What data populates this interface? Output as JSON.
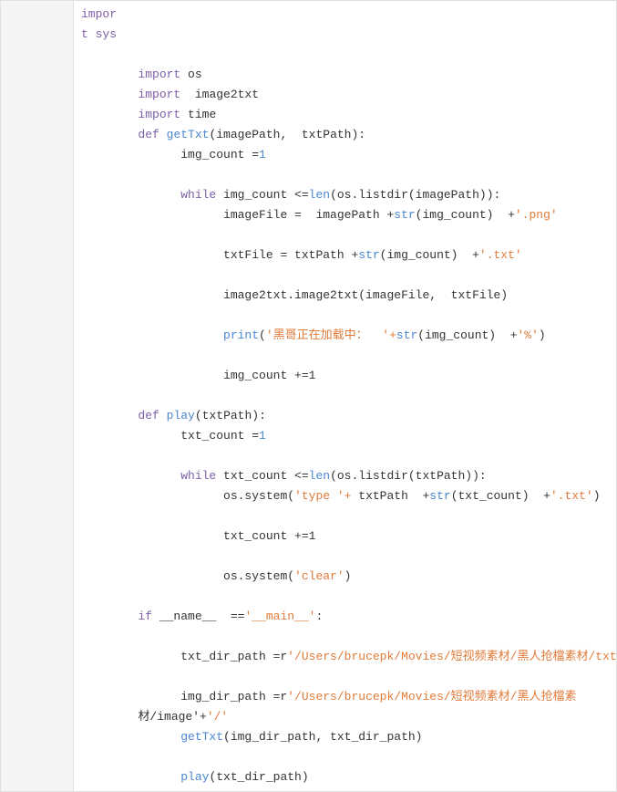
{
  "lines": [
    {
      "num": "",
      "tokens": [
        {
          "t": "kw",
          "v": "impor"
        }
      ]
    },
    {
      "num": "",
      "tokens": [
        {
          "t": "kw",
          "v": "t sys"
        }
      ]
    },
    {
      "num": "",
      "tokens": []
    },
    {
      "num": "",
      "tokens": [
        {
          "t": "plain",
          "v": "        "
        },
        {
          "t": "kw",
          "v": "import"
        },
        {
          "t": "plain",
          "v": " os"
        }
      ]
    },
    {
      "num": "",
      "tokens": [
        {
          "t": "plain",
          "v": "        "
        },
        {
          "t": "kw",
          "v": "import"
        },
        {
          "t": "plain",
          "v": "  image2txt"
        }
      ]
    },
    {
      "num": "",
      "tokens": [
        {
          "t": "plain",
          "v": "        "
        },
        {
          "t": "kw",
          "v": "import"
        },
        {
          "t": "plain",
          "v": " time"
        }
      ]
    },
    {
      "num": "",
      "tokens": [
        {
          "t": "plain",
          "v": "        "
        },
        {
          "t": "kw",
          "v": "def"
        },
        {
          "t": "plain",
          "v": " "
        },
        {
          "t": "fn",
          "v": "getTxt"
        },
        {
          "t": "plain",
          "v": "(imagePath,  txtPath):"
        }
      ]
    },
    {
      "num": "",
      "tokens": [
        {
          "t": "plain",
          "v": "              "
        },
        {
          "t": "plain",
          "v": "img_count ="
        },
        {
          "t": "num",
          "v": "1"
        }
      ]
    },
    {
      "num": "",
      "tokens": []
    },
    {
      "num": "",
      "tokens": [
        {
          "t": "plain",
          "v": "              "
        },
        {
          "t": "kw",
          "v": "while"
        },
        {
          "t": "plain",
          "v": " img_count <="
        },
        {
          "t": "builtin",
          "v": "len"
        },
        {
          "t": "plain",
          "v": "(os.listdir(imagePath)):"
        }
      ]
    },
    {
      "num": "",
      "tokens": [
        {
          "t": "plain",
          "v": "                    "
        },
        {
          "t": "plain",
          "v": "imageFile =  imagePath +"
        },
        {
          "t": "builtin",
          "v": "str"
        },
        {
          "t": "plain",
          "v": "(img_count)  +"
        },
        {
          "t": "str",
          "v": "'.png'"
        }
      ]
    },
    {
      "num": "",
      "tokens": []
    },
    {
      "num": "",
      "tokens": [
        {
          "t": "plain",
          "v": "                    "
        },
        {
          "t": "plain",
          "v": "txtFile = txtPath +"
        },
        {
          "t": "builtin",
          "v": "str"
        },
        {
          "t": "plain",
          "v": "(img_count)  +"
        },
        {
          "t": "str",
          "v": "'.txt'"
        }
      ]
    },
    {
      "num": "",
      "tokens": []
    },
    {
      "num": "",
      "tokens": [
        {
          "t": "plain",
          "v": "                    "
        },
        {
          "t": "plain",
          "v": "image2txt.image2txt(imageFile,  txtFile)"
        }
      ]
    },
    {
      "num": "",
      "tokens": []
    },
    {
      "num": "",
      "tokens": [
        {
          "t": "plain",
          "v": "                    "
        },
        {
          "t": "builtin",
          "v": "print"
        },
        {
          "t": "plain",
          "v": "("
        },
        {
          "t": "str",
          "v": "'黑哥正在加载中：  '+"
        },
        {
          "t": "builtin",
          "v": "str"
        },
        {
          "t": "plain",
          "v": "(img_count)  +"
        },
        {
          "t": "str",
          "v": "'%'"
        }
      ],
      "extra": ")"
    },
    {
      "num": "",
      "tokens": []
    },
    {
      "num": "",
      "tokens": [
        {
          "t": "plain",
          "v": "                    "
        },
        {
          "t": "plain",
          "v": "img_count +=1"
        }
      ]
    },
    {
      "num": "",
      "tokens": []
    },
    {
      "num": "",
      "tokens": [
        {
          "t": "plain",
          "v": "        "
        },
        {
          "t": "kw",
          "v": "def"
        },
        {
          "t": "plain",
          "v": " "
        },
        {
          "t": "fn",
          "v": "play"
        },
        {
          "t": "plain",
          "v": "(txtPath):"
        }
      ]
    },
    {
      "num": "",
      "tokens": [
        {
          "t": "plain",
          "v": "              "
        },
        {
          "t": "plain",
          "v": "txt_count ="
        },
        {
          "t": "num",
          "v": "1"
        }
      ]
    },
    {
      "num": "",
      "tokens": []
    },
    {
      "num": "",
      "tokens": [
        {
          "t": "plain",
          "v": "              "
        },
        {
          "t": "kw",
          "v": "while"
        },
        {
          "t": "plain",
          "v": " txt_count <="
        },
        {
          "t": "builtin",
          "v": "len"
        },
        {
          "t": "plain",
          "v": "(os.listdir(txtPath)):"
        }
      ]
    },
    {
      "num": "",
      "tokens": [
        {
          "t": "plain",
          "v": "                    "
        },
        {
          "t": "plain",
          "v": "os.system("
        },
        {
          "t": "str",
          "v": "'type '+"
        },
        {
          "t": "plain",
          "v": " txtPath  +"
        },
        {
          "t": "builtin",
          "v": "str"
        },
        {
          "t": "plain",
          "v": "(txt_count)  +"
        },
        {
          "t": "str",
          "v": "'.txt'"
        }
      ],
      "extra": ")"
    },
    {
      "num": "",
      "tokens": []
    },
    {
      "num": "",
      "tokens": [
        {
          "t": "plain",
          "v": "                    "
        },
        {
          "t": "plain",
          "v": "txt_count +=1"
        }
      ]
    },
    {
      "num": "",
      "tokens": []
    },
    {
      "num": "",
      "tokens": [
        {
          "t": "plain",
          "v": "                    "
        },
        {
          "t": "plain",
          "v": "os.system("
        },
        {
          "t": "str",
          "v": "'clear'"
        }
      ],
      "extra": ")"
    },
    {
      "num": "",
      "tokens": []
    },
    {
      "num": "",
      "tokens": [
        {
          "t": "plain",
          "v": "        "
        },
        {
          "t": "kw",
          "v": "if"
        },
        {
          "t": "plain",
          "v": " __name__  =="
        },
        {
          "t": "str",
          "v": "'__main__'"
        }
      ],
      "extra": ":"
    },
    {
      "num": "",
      "tokens": []
    },
    {
      "num": "",
      "tokens": [
        {
          "t": "plain",
          "v": "              "
        },
        {
          "t": "plain",
          "v": "txt_dir_path =r"
        },
        {
          "t": "str",
          "v": "'/Users/brucepk/Movies/短视频素材/黑人抢檔素材/txt'+"
        },
        {
          "t": "str",
          "v": "'/'"
        }
      ]
    },
    {
      "num": "",
      "tokens": []
    },
    {
      "num": "",
      "tokens": [
        {
          "t": "plain",
          "v": "              "
        },
        {
          "t": "plain",
          "v": "img_dir_path =r"
        },
        {
          "t": "str",
          "v": "'/Users/brucepk/Movies/短视频素材/黑人抢檔素"
        }
      ]
    },
    {
      "num": "",
      "tokens": [
        {
          "t": "plain",
          "v": "        材/image'+"
        },
        {
          "t": "str",
          "v": "'/'"
        }
      ]
    },
    {
      "num": "",
      "tokens": [
        {
          "t": "plain",
          "v": "              "
        },
        {
          "t": "fn",
          "v": "getTxt"
        },
        {
          "t": "plain",
          "v": "(img_dir_path, txt_dir_path)"
        }
      ]
    },
    {
      "num": "",
      "tokens": []
    },
    {
      "num": "",
      "tokens": [
        {
          "t": "plain",
          "v": "              "
        },
        {
          "t": "fn",
          "v": "play"
        },
        {
          "t": "plain",
          "v": "(txt_dir_path)"
        }
      ]
    }
  ]
}
